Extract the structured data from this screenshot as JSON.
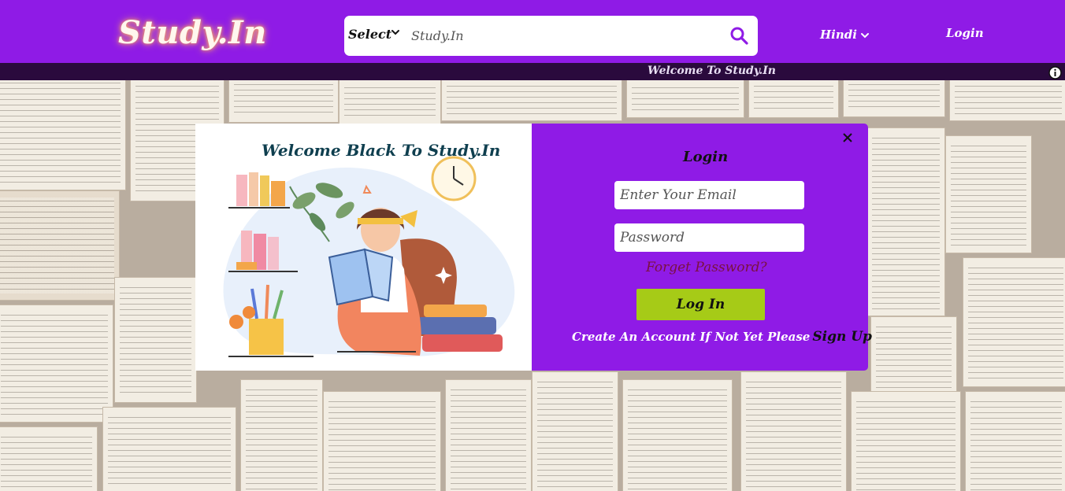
{
  "header": {
    "logo": "Study.In",
    "select_label": "Select",
    "search_placeholder": "Study.In",
    "language": "Hindi",
    "login": "Login"
  },
  "marquee": {
    "text": "Welcome To Study.In"
  },
  "modal": {
    "welcome_title": "Welcome Black To Study.In",
    "login_title": "Login",
    "email_placeholder": "Enter Your Email",
    "password_placeholder": "Password",
    "forgot": "Forget Password?",
    "login_button": "Log In",
    "create_text": "Create An Account If Not Yet Please",
    "signup": "Sign Up"
  },
  "colors": {
    "header_bg": "#8f1be6",
    "marquee_bg": "#2a0a3d",
    "button_green": "#a6cb17",
    "forgot_text": "#7a1140"
  },
  "icons": [
    "chevron-down-icon",
    "search-icon",
    "info-icon",
    "close-icon"
  ]
}
